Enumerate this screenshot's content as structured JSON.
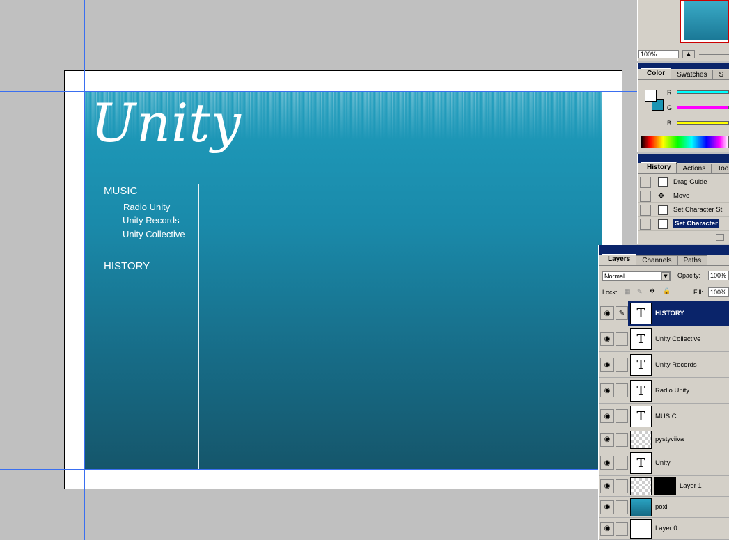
{
  "canvas": {
    "logo": "Unity",
    "nav": {
      "music": "MUSIC",
      "music_items": [
        "Radio Unity",
        "Unity Records",
        "Unity Collective"
      ],
      "history": "HISTORY"
    }
  },
  "navigator": {
    "zoom": "100%"
  },
  "color_palette": {
    "tabs": [
      "Color",
      "Swatches",
      "S"
    ],
    "channels": [
      "R",
      "G",
      "B"
    ],
    "colors": {
      "r_bar": "#00ffff",
      "g_bar": "#ff00ff",
      "b_bar": "#ffff00",
      "background": "#1b95b3"
    }
  },
  "history_palette": {
    "tabs": [
      "History",
      "Actions",
      "Tool"
    ],
    "items": [
      "Drag Guide",
      "Move",
      "Set Character St",
      "Set Character"
    ]
  },
  "layers_palette": {
    "tabs": [
      "Layers",
      "Channels",
      "Paths"
    ],
    "blend_mode": "Normal",
    "opacity_label": "Opacity:",
    "opacity_value": "100%",
    "lock_label": "Lock:",
    "fill_label": "Fill:",
    "fill_value": "100%",
    "layers": [
      "HISTORY",
      "Unity Collective",
      "Unity Records",
      "Radio Unity",
      "MUSIC",
      "pystyviiva",
      "Unity",
      "Layer 1",
      "poxi",
      "Layer 0"
    ],
    "text_layer_glyph": "T"
  }
}
